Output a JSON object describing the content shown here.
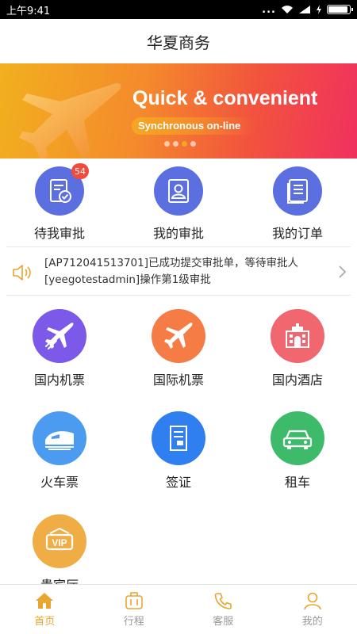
{
  "status_bar": {
    "time": "上午9:41",
    "signal_dots": "..."
  },
  "header": {
    "title": "华夏商务"
  },
  "banner": {
    "title": "Quick & convenient",
    "subtitle": "Synchronous on-line",
    "dot_count": 4,
    "active_dot_index": 2
  },
  "approvals": {
    "items": [
      {
        "label": "待我审批",
        "icon": "approval-check-icon",
        "badge": "54"
      },
      {
        "label": "我的审批",
        "icon": "person-card-icon"
      },
      {
        "label": "我的订单",
        "icon": "document-list-icon"
      }
    ]
  },
  "notice": {
    "icon": "speaker-icon",
    "text": "[AP712041513701]已成功提交审批单，等待审批人[yeegotestadmin]操作第1级审批"
  },
  "services": {
    "items": [
      {
        "label": "国内机票",
        "icon": "plane-icon",
        "color": "#7c59e8"
      },
      {
        "label": "国际机票",
        "icon": "plane-icon",
        "color": "#f57c45"
      },
      {
        "label": "国内酒店",
        "icon": "hotel-icon",
        "color": "#f0676f"
      },
      {
        "label": "火车票",
        "icon": "train-icon",
        "color": "#4b9cf0"
      },
      {
        "label": "签证",
        "icon": "visa-document-icon",
        "color": "#2f7ff0"
      },
      {
        "label": "租车",
        "icon": "car-icon",
        "color": "#3dbb6a"
      },
      {
        "label": "贵宾厅",
        "icon": "vip-icon",
        "color": "#f0ad45"
      }
    ]
  },
  "bottom_nav": {
    "items": [
      {
        "label": "首页",
        "icon": "home-icon",
        "active": true
      },
      {
        "label": "行程",
        "icon": "luggage-icon",
        "active": false
      },
      {
        "label": "客服",
        "icon": "phone-icon",
        "active": false
      },
      {
        "label": "我的",
        "icon": "user-icon",
        "active": false
      }
    ]
  },
  "colors": {
    "accent": "#e8a530",
    "approval_blue": "#5b6fe0",
    "badge_red": "#f04b3c"
  }
}
